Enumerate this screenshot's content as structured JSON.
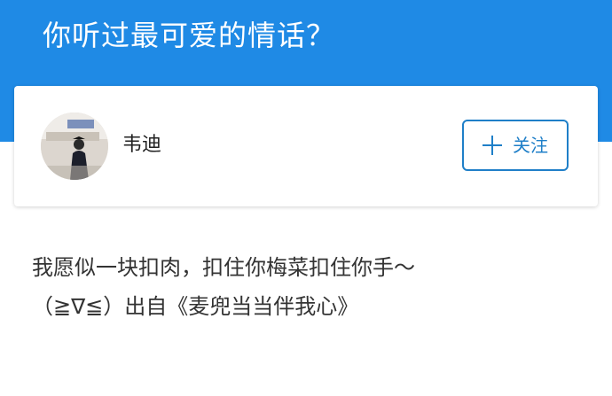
{
  "header": {
    "question_title": "你听过最可爱的情话？"
  },
  "author": {
    "name": "韦迪",
    "avatar_icon": "user-avatar-photo",
    "follow_label": "关注",
    "follow_icon": "plus-icon"
  },
  "answer": {
    "lines": [
      "我愿似一块扣肉，扣住你梅菜扣住你手～",
      "（≧∇≦）出自《麦兜当当伴我心》"
    ]
  },
  "colors": {
    "header_bg": "#1f8ae5",
    "accent": "#1f7fc8"
  }
}
